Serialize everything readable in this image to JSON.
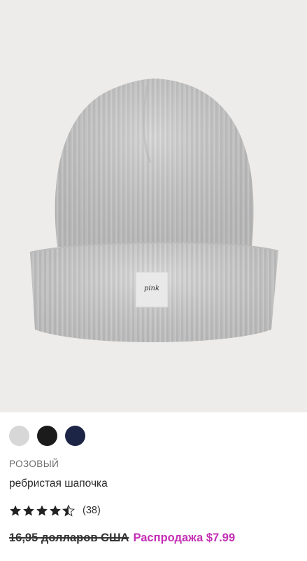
{
  "product": {
    "brand": "РОЗОВЫЙ",
    "name": "ребристая шапочка",
    "image_icon": "knit-beanie-image",
    "label_text": "pink",
    "rating": {
      "value": 4.5,
      "max": 5,
      "count_text": "(38)"
    },
    "price": {
      "original": "16,95 долларов США",
      "sale": "Распродажа $7.99"
    },
    "swatches": [
      {
        "color": "#d7d7d7"
      },
      {
        "color": "#1b1b1b"
      },
      {
        "color": "#1d2547"
      }
    ]
  },
  "colors": {
    "sale": "#c42fb5",
    "image_bg": "#eeecea",
    "star": "#222222"
  }
}
